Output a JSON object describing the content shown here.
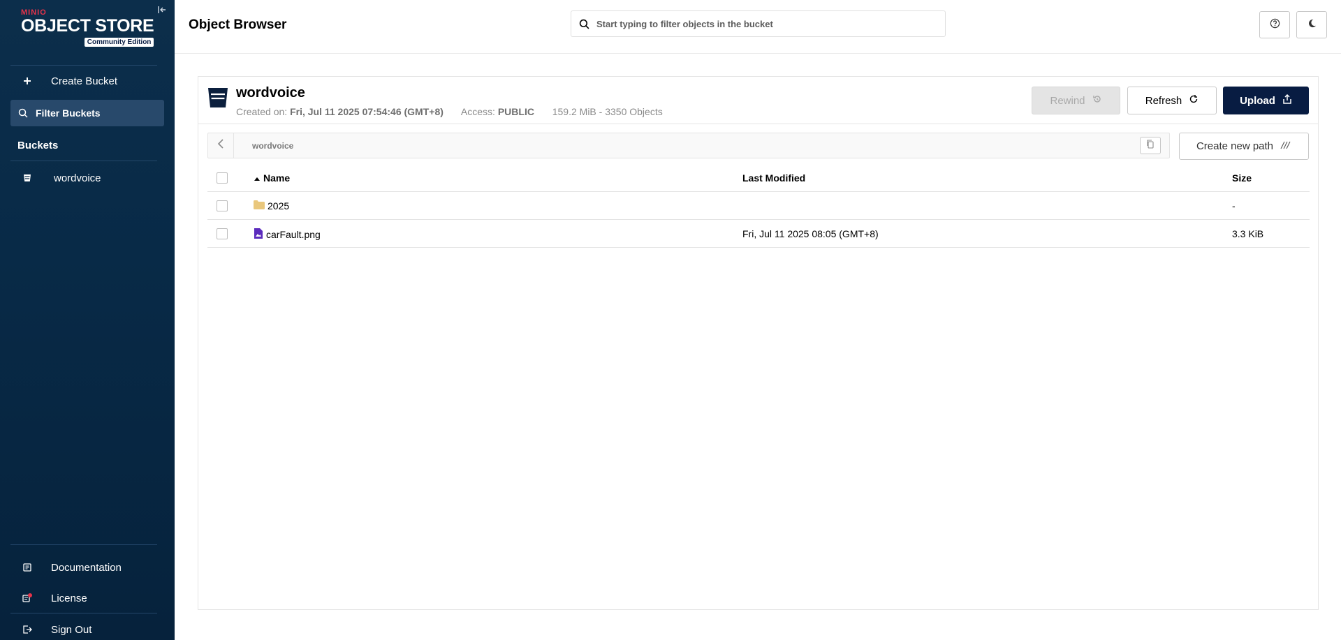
{
  "sidebar": {
    "logo": {
      "brand": "MINIO",
      "product": "OBJECT STORE",
      "edition": "Community Edition"
    },
    "create_bucket": "Create Bucket",
    "filter_placeholder": "Filter Buckets",
    "buckets_heading": "Buckets",
    "buckets": [
      {
        "name": "wordvoice"
      }
    ],
    "footer": {
      "documentation": "Documentation",
      "license": "License",
      "sign_out": "Sign Out"
    }
  },
  "header": {
    "title": "Object Browser",
    "search_placeholder": "Start typing to filter objects in the bucket"
  },
  "bucket": {
    "name": "wordvoice",
    "created_label": "Created on:",
    "created_value": "Fri, Jul 11 2025 07:54:46 (GMT+8)",
    "access_label": "Access:",
    "access_value": "PUBLIC",
    "usage": "159.2 MiB - 3350 Objects"
  },
  "actions": {
    "rewind": "Rewind",
    "refresh": "Refresh",
    "upload": "Upload",
    "create_path": "Create new path"
  },
  "breadcrumb": {
    "path": "wordvoice"
  },
  "table": {
    "columns": {
      "name": "Name",
      "last_modified": "Last Modified",
      "size": "Size"
    },
    "rows": [
      {
        "type": "folder",
        "name": "2025",
        "last_modified": "",
        "size": "-"
      },
      {
        "type": "file",
        "name": "carFault.png",
        "last_modified": "Fri, Jul 11 2025 08:05 (GMT+8)",
        "size": "3.3 KiB"
      }
    ]
  },
  "colors": {
    "sidebar_bg": "#082a47",
    "primary": "#081c42",
    "brand_red": "#e8334a",
    "folder": "#e9c77c",
    "file_icon": "#5b2bbd"
  }
}
